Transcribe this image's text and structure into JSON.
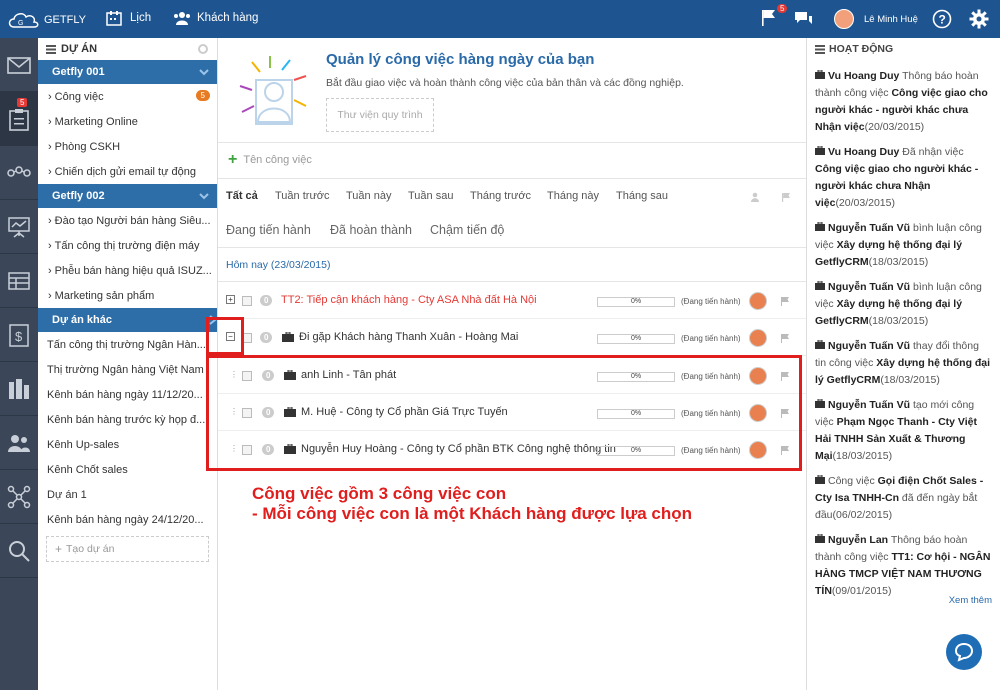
{
  "topbar": {
    "brand": "GETFLY",
    "nav_calendar": "Lịch",
    "nav_customers": "Khách hàng",
    "notif_count": "5",
    "user_name": "Lê Minh Huệ"
  },
  "leftbar": {
    "task_badge": "5",
    "icons": [
      "mail-icon",
      "tasks-icon",
      "network-icon",
      "presentation-icon",
      "table-icon",
      "money-icon",
      "building-icon",
      "users-icon",
      "share-icon",
      "search-icon"
    ]
  },
  "sidebar": {
    "title": "DỰ ÁN",
    "group1": {
      "label": "Getfly 001",
      "items": [
        {
          "label": "Công việc",
          "badge": "5"
        },
        {
          "label": "Marketing Online"
        },
        {
          "label": "Phòng CSKH"
        },
        {
          "label": "Chiến dịch gửi email tự động"
        }
      ]
    },
    "group2": {
      "label": "Getfly 002",
      "items": [
        {
          "label": "Đào tạo Người bán hàng Siêu..."
        },
        {
          "label": "Tấn công thị trường điện máy"
        },
        {
          "label": "Phễu bán hàng hiệu quả ISUZ..."
        },
        {
          "label": "Marketing sản phẩm"
        }
      ]
    },
    "group3": {
      "label": "Dự án khác",
      "items": [
        {
          "label": "Tấn công thị trường Ngân Hàn..."
        },
        {
          "label": "Thị trường Ngân hàng Việt Nam"
        },
        {
          "label": "Kênh bán hàng ngày 11/12/20..."
        },
        {
          "label": "Kênh bán hàng trước kỳ họp đ..."
        },
        {
          "label": "Kênh Up-sales"
        },
        {
          "label": "Kênh Chốt sales"
        },
        {
          "label": "Dự án 1"
        },
        {
          "label": "Kênh bán hàng ngày 24/12/20..."
        }
      ]
    },
    "add_project": "Tạo dự án"
  },
  "main": {
    "intro_title": "Quản lý công việc hàng ngày của bạn",
    "intro_sub": "Bắt đầu giao việc và hoàn thành công việc của bản thân và các đồng nghiệp.",
    "template_btn": "Thư viện quy trình",
    "new_task_placeholder": "Tên công việc",
    "time_tabs": [
      "Tất cả",
      "Tuần trước",
      "Tuần này",
      "Tuần sau",
      "Tháng trước",
      "Tháng này",
      "Tháng sau"
    ],
    "status_tabs": [
      "Đang tiến hành",
      "Đã hoàn thành",
      "Chậm tiến độ"
    ],
    "date_header": "Hôm nay (23/03/2015)",
    "tasks": [
      {
        "count": "0",
        "title": "TT2: Tiếp cận khách hàng - Cty ASA Nhà đất Hà Nội",
        "progress": "0%",
        "status": "(Đang tiến hành)",
        "color": "#e53935"
      },
      {
        "count": "0",
        "title": "Đi gặp Khách hàng Thanh Xuân - Hoàng Mai",
        "progress": "0%",
        "status": "(Đang tiến hành)",
        "color": "#333333"
      },
      {
        "count": "0",
        "title": "anh Linh - Tân phát",
        "progress": "0%",
        "status": "(Đang tiến hành)",
        "color": "#333333"
      },
      {
        "count": "0",
        "title": "M. Huệ - Công ty Cổ phần Giá Trực Tuyến",
        "progress": "0%",
        "status": "(Đang tiến hành)",
        "color": "#333333"
      },
      {
        "count": "0",
        "title": "Nguyễn Huy Hoàng - Công ty Cổ phần BTK Công nghệ thông tin",
        "progress": "0%",
        "status": "(Đang tiến hành)",
        "color": "#333333"
      }
    ],
    "annotation_line1": "Công việc gồm 3 công việc con",
    "annotation_line2": "- Mỗi công việc con là một Khách hàng được lựa chọn"
  },
  "activity": {
    "title": "HOẠT ĐỘNG",
    "more": "Xem thêm",
    "items": [
      {
        "who": "Vu Hoang Duy",
        "a1": " Thông báo hoàn thành công việc ",
        "obj": "Công việc giao cho người khác - người khác chưa Nhận việc",
        "a2": "",
        "date": "(20/03/2015)"
      },
      {
        "who": "Vu Hoang Duy",
        "a1": " Đã nhận việc ",
        "obj": "Công việc giao cho người khác - người khác chưa Nhận việc",
        "a2": "",
        "date": "(20/03/2015)"
      },
      {
        "who": "Nguyễn Tuấn Vũ",
        "a1": " bình luận công việc ",
        "obj": "Xây dựng hệ thống đại lý GetflyCRM",
        "a2": "",
        "date": "(18/03/2015)"
      },
      {
        "who": "Nguyễn Tuấn Vũ",
        "a1": " bình luận công việc ",
        "obj": "Xây dựng hệ thống đại lý GetflyCRM",
        "a2": "",
        "date": "(18/03/2015)"
      },
      {
        "who": "Nguyễn Tuấn Vũ",
        "a1": " thay đổi thông tin công việc ",
        "obj": "Xây dựng hệ thống đại lý GetflyCRM",
        "a2": "",
        "date": "(18/03/2015)"
      },
      {
        "who": "Nguyễn Tuấn Vũ",
        "a1": " tạo mới công việc ",
        "obj": "Phạm Ngọc Thanh - Cty Việt Hải TNHH Sản Xuất & Thương Mại",
        "a2": "",
        "date": "(18/03/2015)"
      },
      {
        "who": "",
        "a1": "Công việc ",
        "obj": "Gọi điện Chốt Sales - Cty Isa TNHH-Cn",
        "a2": " đã đến ngày bắt đầu",
        "date": "(06/02/2015)"
      },
      {
        "who": "Nguyễn Lan",
        "a1": " Thông báo hoàn thành công việc ",
        "obj": "TT1: Cơ hội - NGÂN HÀNG TMCP VIỆT NAM THƯƠNG TÍN",
        "a2": "",
        "date": "(09/01/2015)"
      }
    ]
  }
}
